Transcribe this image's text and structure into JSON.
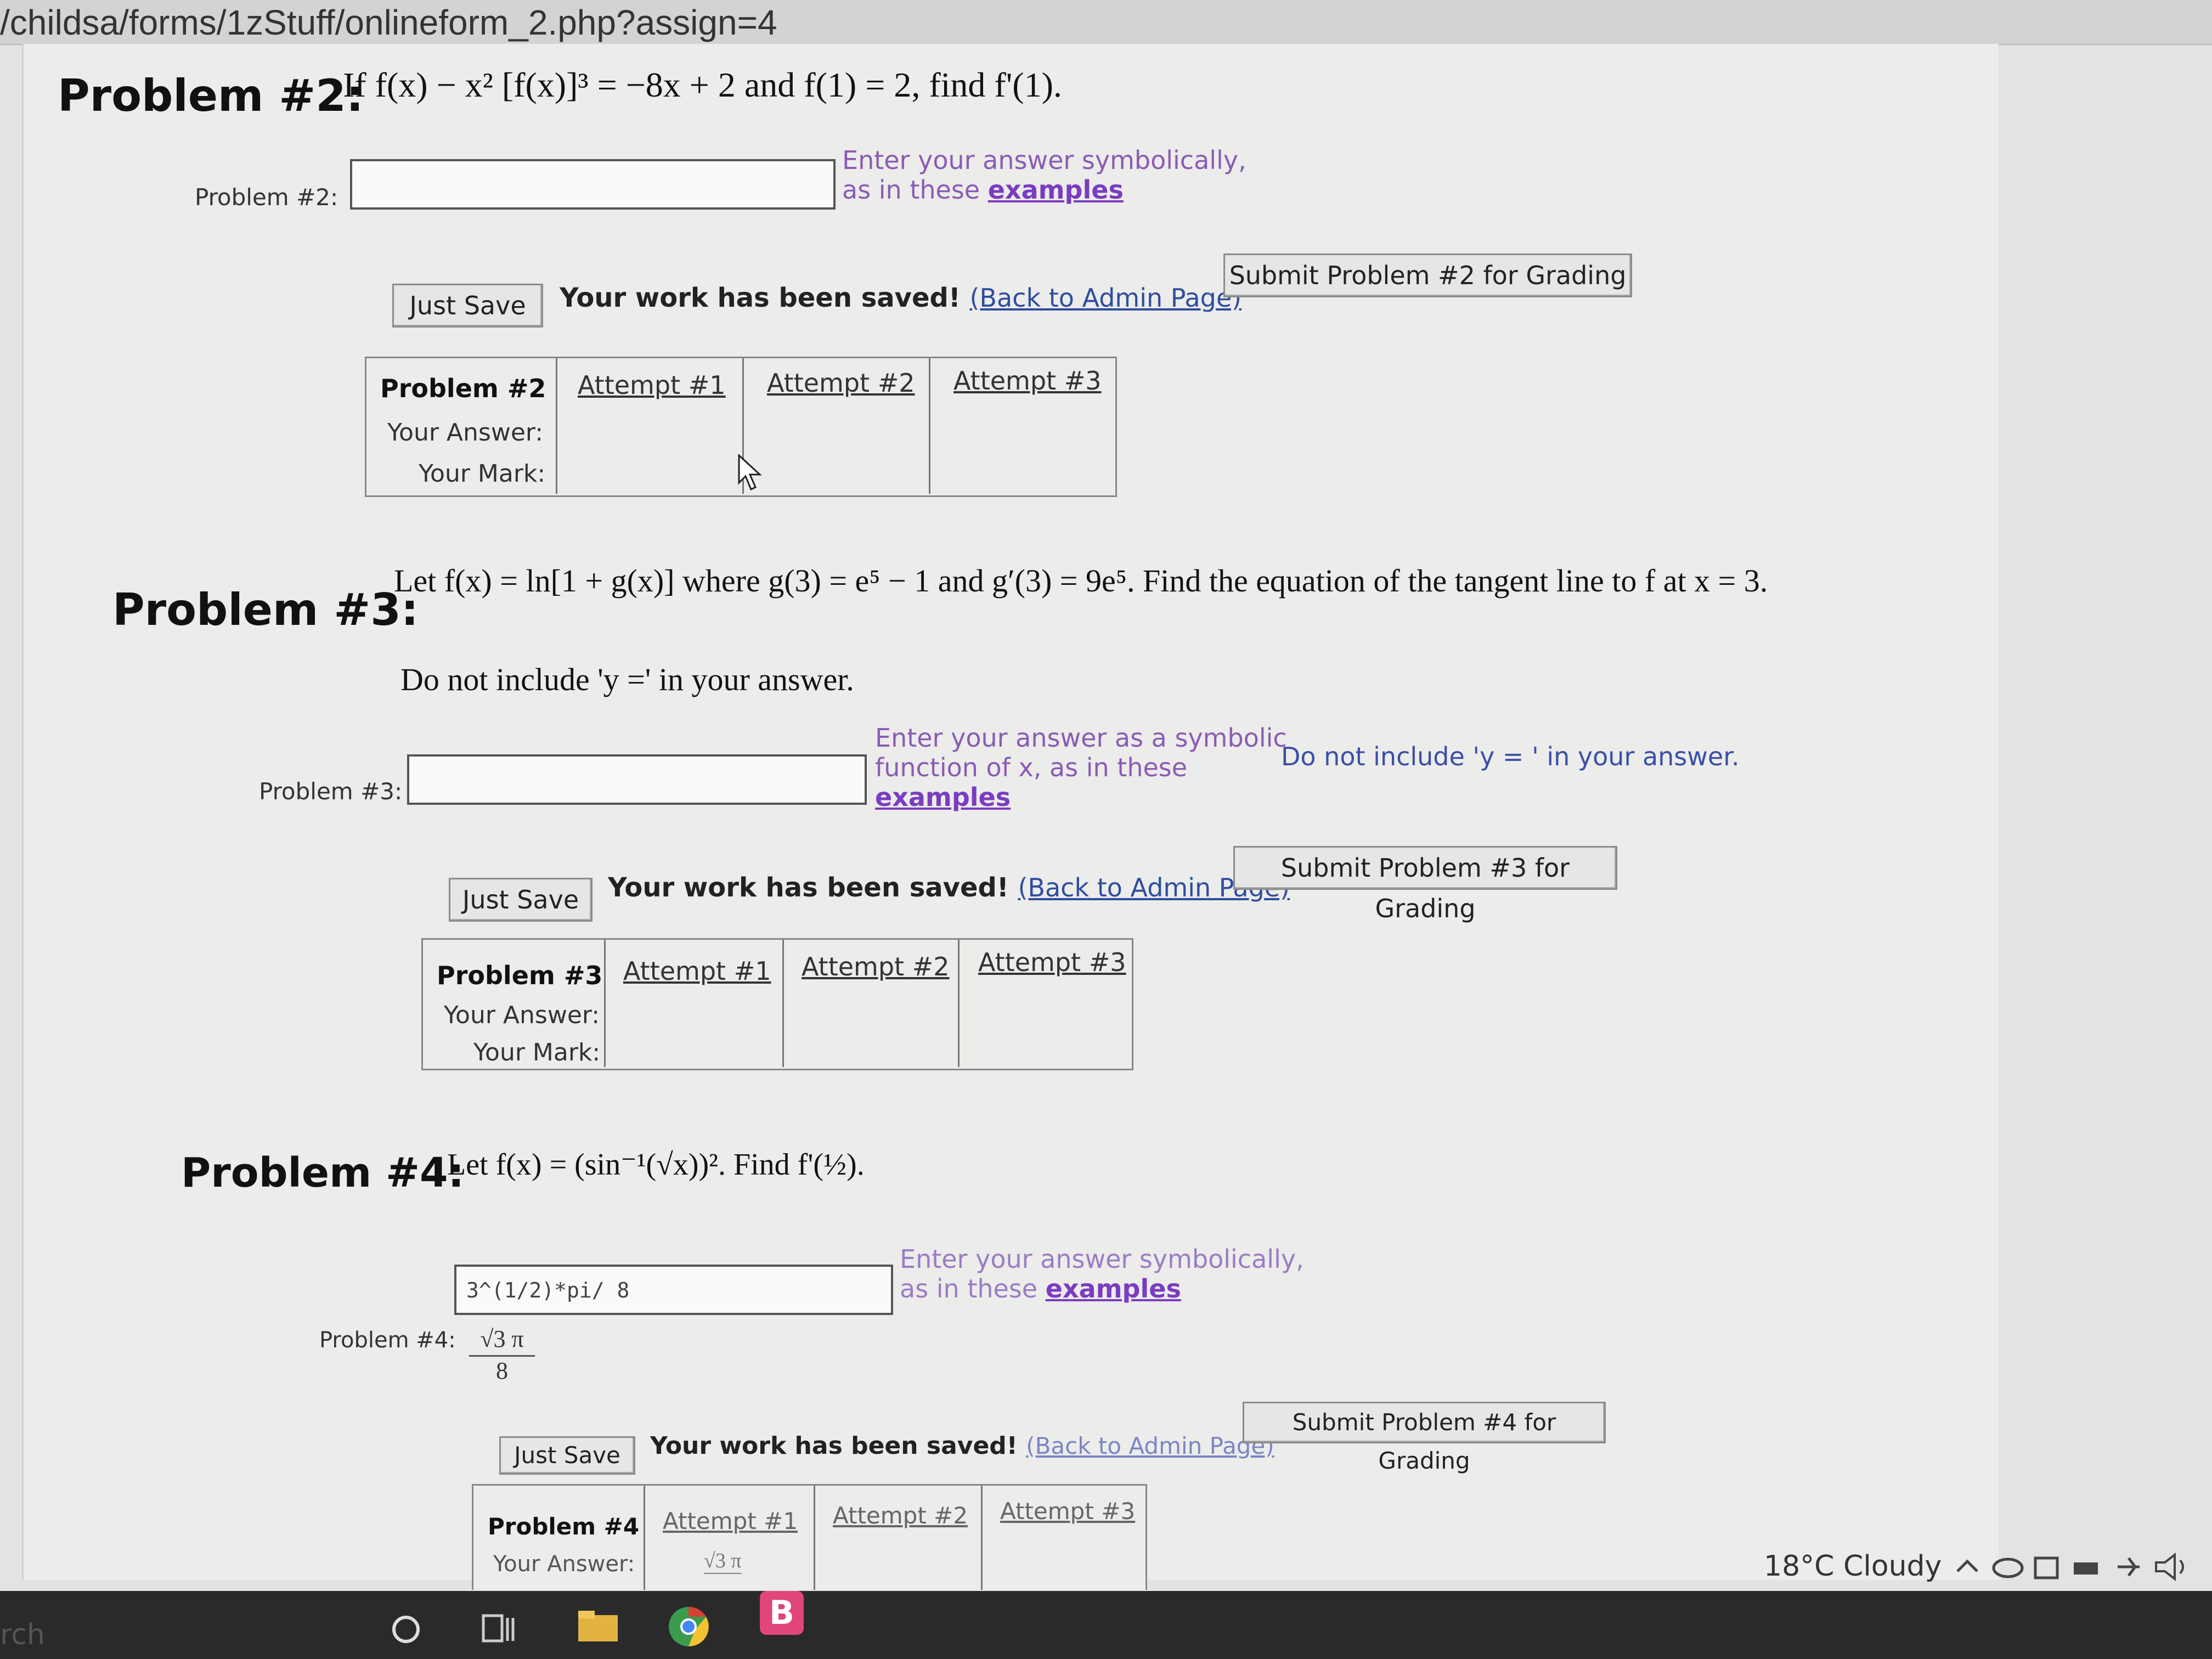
{
  "browser": {
    "url": "/childsa/forms/1zStuff/onlineform_2.php?assign=4"
  },
  "problems": [
    {
      "heading": "Problem #2:",
      "statement_prefix": "If",
      "statement": "f(x) − x² [f(x)]³ = −8x + 2  and  f(1) = 2,  find f'(1).",
      "field_label": "Problem #2:",
      "input_value": "",
      "hint_line1": "Enter your answer symbolically,",
      "hint_line2": "as in these",
      "hint_link": "examples",
      "save_label": "Just Save",
      "saved_text": "Your work has been saved!",
      "admin_link": "(Back to Admin Page)",
      "submit_label": "Submit Problem #2 for Grading",
      "table": {
        "header": "Problem #2",
        "attempts": [
          "Attempt #1",
          "Attempt #2",
          "Attempt #3"
        ],
        "answer_label": "Your Answer:",
        "mark_label": "Your Mark:"
      }
    },
    {
      "heading": "Problem #3:",
      "statement_prefix": "Let",
      "statement": "f(x) = ln[1 + g(x)]  where g(3) = e⁵ − 1 and g′(3) = 9e⁵. Find the equation of the tangent line to f at x = 3.",
      "note": "Do not include 'y =' in your answer.",
      "field_label": "Problem #3:",
      "input_value": "",
      "hint_line1": "Enter your answer as a symbolic",
      "hint_line2": "function of x, as in these",
      "hint_link": "examples",
      "side_note": "Do not include 'y = ' in your answer.",
      "save_label": "Just Save",
      "saved_text": "Your work has been saved!",
      "admin_link": "(Back to Admin Page)",
      "submit_label": "Submit Problem #3 for Grading",
      "table": {
        "header": "Problem #3",
        "attempts": [
          "Attempt #1",
          "Attempt #2",
          "Attempt #3"
        ],
        "answer_label": "Your Answer:",
        "mark_label": "Your Mark:"
      }
    },
    {
      "heading": "Problem #4:",
      "statement_prefix": "Let",
      "statement": "f(x) = (sin⁻¹(√x))².  Find f'(½).",
      "field_label": "Problem #4:",
      "input_value": "3^(1/2)*pi/ 8",
      "preview_num": "√3 π",
      "preview_den": "8",
      "hint_line1": "Enter your answer symbolically,",
      "hint_line2": "as in these",
      "hint_link": "examples",
      "save_label": "Just Save",
      "saved_text": "Your work has been saved!",
      "admin_link": "(Back to Admin Page)",
      "submit_label": "Submit Problem #4 for Grading",
      "table": {
        "header": "Problem #4",
        "attempts": [
          "Attempt #1",
          "Attempt #2",
          "Attempt #3"
        ],
        "answer_label": "Your Answer:",
        "answer_attempt1": "√3 π"
      }
    }
  ],
  "taskbar": {
    "search": "rch",
    "weather": "18°C  Cloudy",
    "browser_badge": "B"
  }
}
